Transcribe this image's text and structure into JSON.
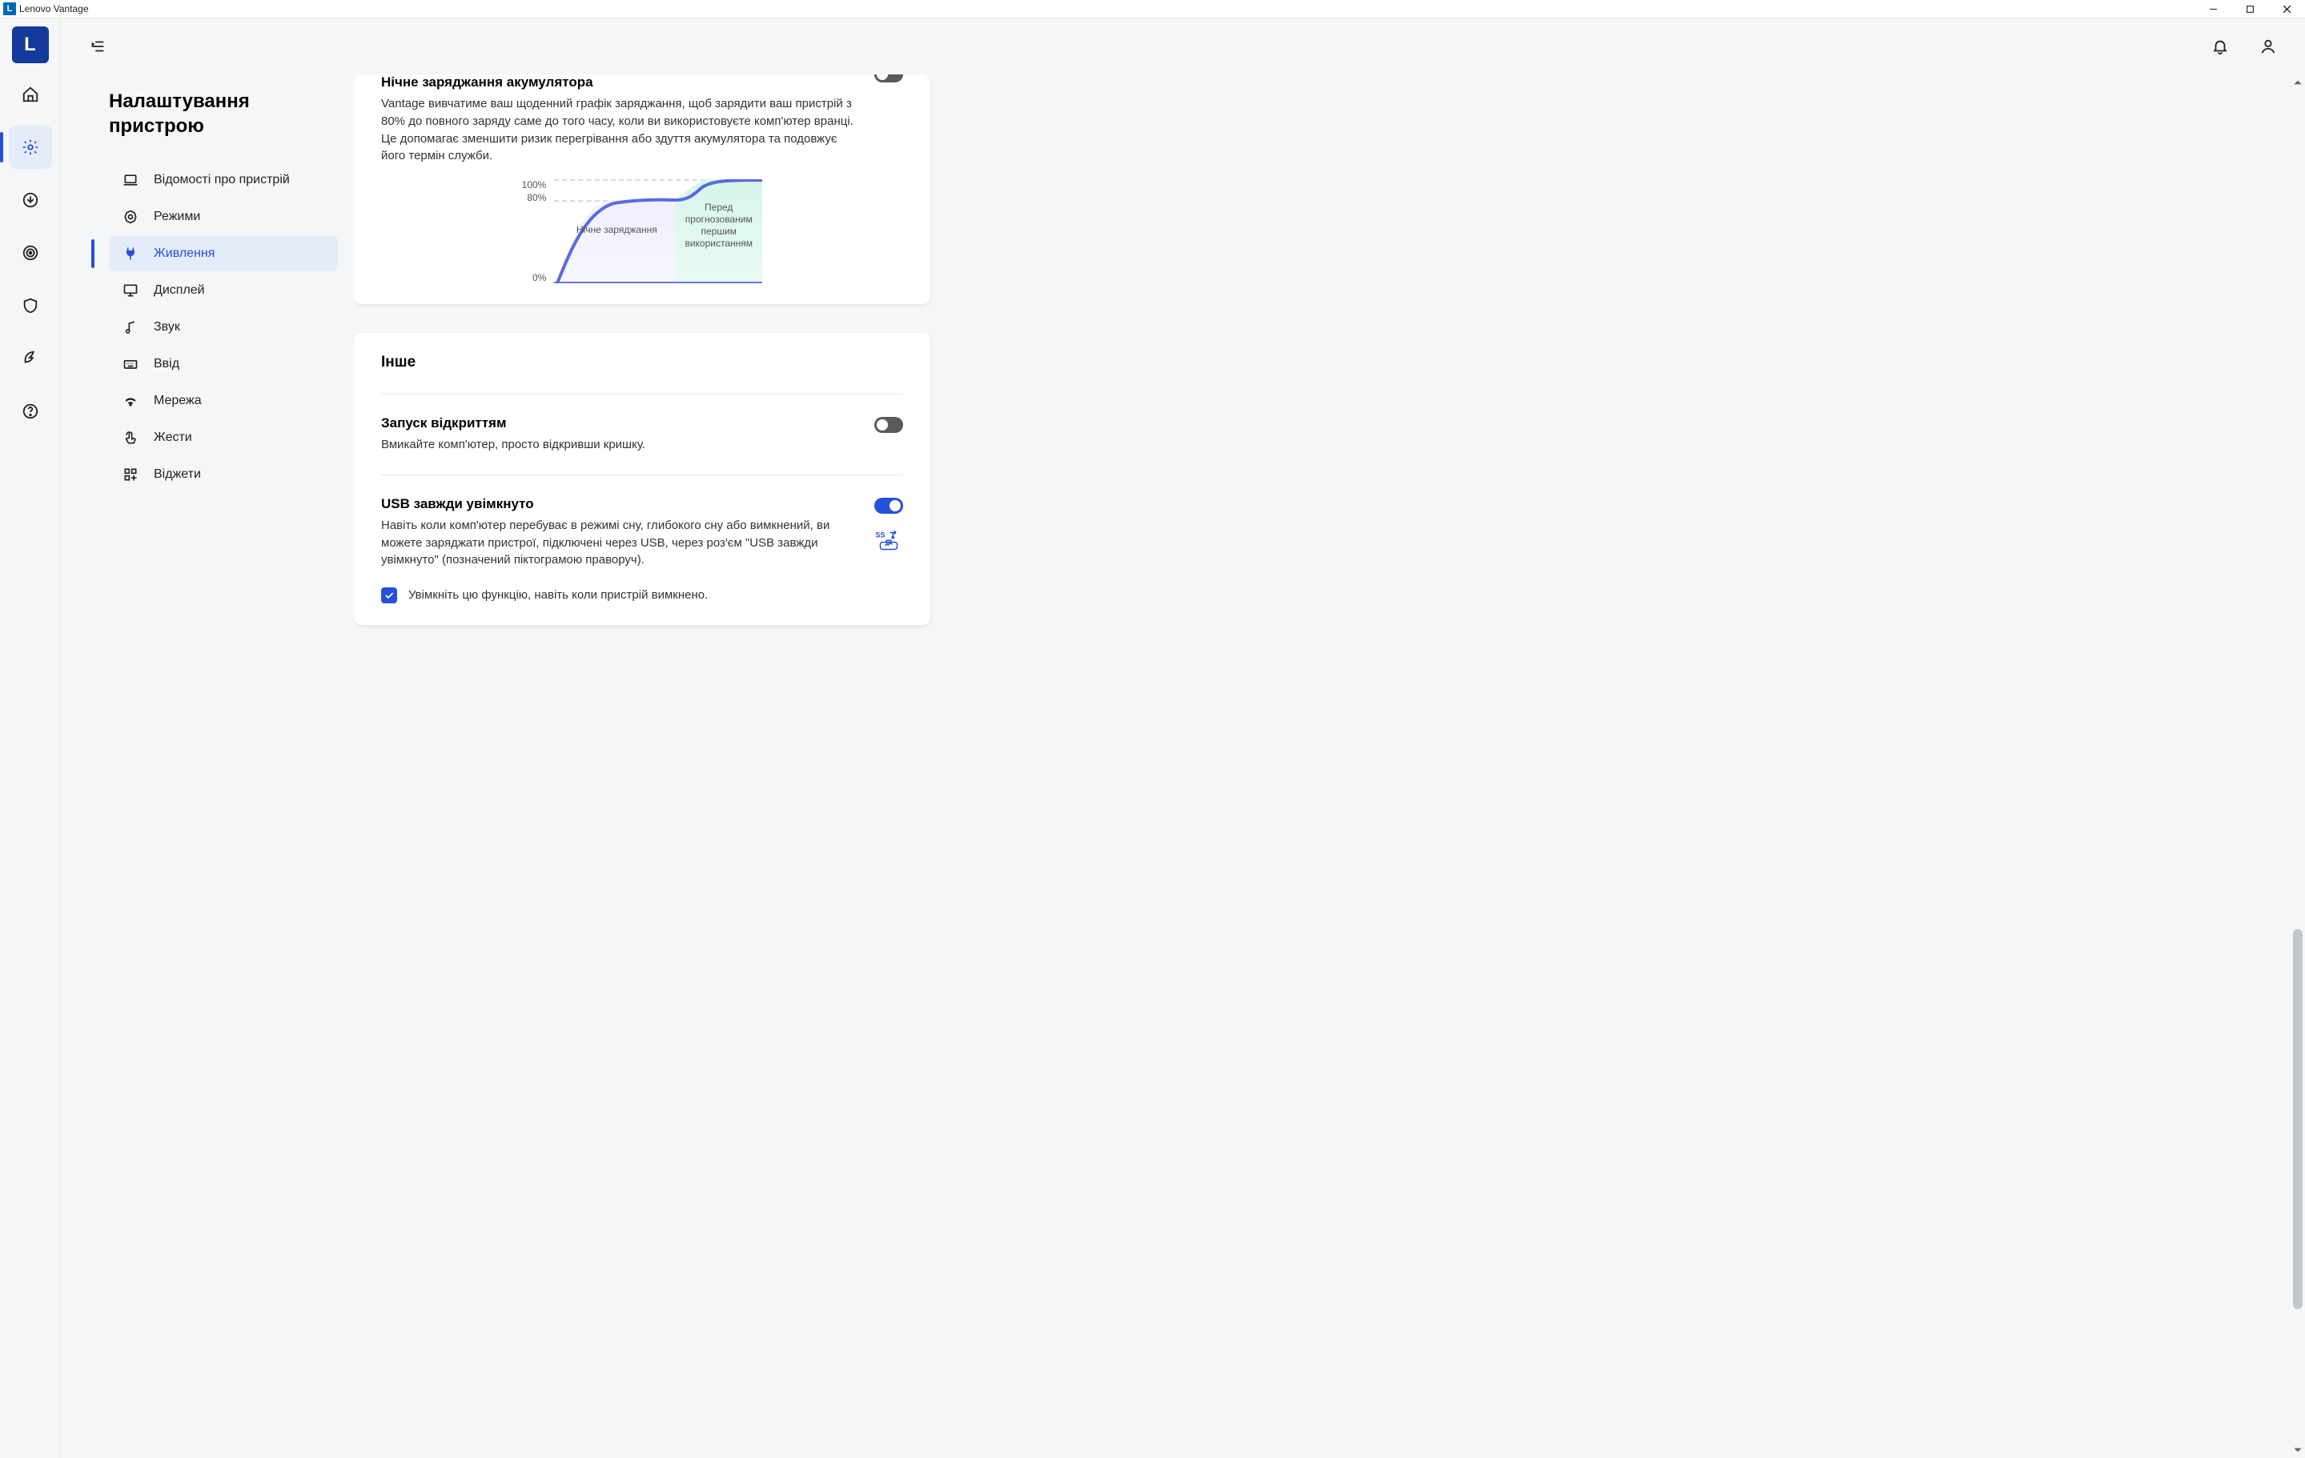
{
  "window": {
    "title": "Lenovo Vantage",
    "app_icon_letter": "L"
  },
  "logo_letter": "L",
  "rail": [
    {
      "id": "home"
    },
    {
      "id": "settings",
      "active": true
    },
    {
      "id": "downloads"
    },
    {
      "id": "diagnostics"
    },
    {
      "id": "security"
    },
    {
      "id": "performance"
    },
    {
      "id": "help"
    }
  ],
  "page_title": "Налаштування пристрою",
  "nav": [
    {
      "id": "device-info",
      "label": "Відомості про пристрій"
    },
    {
      "id": "modes",
      "label": "Режими"
    },
    {
      "id": "power",
      "label": "Живлення",
      "active": true
    },
    {
      "id": "display",
      "label": "Дисплей"
    },
    {
      "id": "audio",
      "label": "Звук"
    },
    {
      "id": "input",
      "label": "Ввід"
    },
    {
      "id": "network",
      "label": "Мережа"
    },
    {
      "id": "gestures",
      "label": "Жести"
    },
    {
      "id": "widgets",
      "label": "Віджети"
    }
  ],
  "night_charge": {
    "title": "Нічне заряджання акумулятора",
    "desc": "Vantage вивчатиме ваш щоденний графік заряджання, щоб зарядити ваш пристрій з 80% до повного заряду саме до того часу, коли ви використовуєте комп'ютер вранці. Це допомагає зменшити ризик перегрівання або здуття акумулятора та подовжує його термін служби.",
    "enabled": false
  },
  "other_section_title": "Інше",
  "flip_to_start": {
    "title": "Запуск відкриттям",
    "desc": "Вмикайте комп'ютер, просто відкривши кришку.",
    "enabled": false
  },
  "always_on_usb": {
    "title": "USB завжди увімкнуто",
    "desc": "Навіть коли комп'ютер перебуває в режимі сну, глибокого сну або вимкнений, ви можете заряджати пристрої, підключені через USB, через роз'єм \"USB завжди увімкнуто\" (позначений піктограмою праворуч).",
    "enabled": true,
    "checkbox_label": "Увімкніть цю функцію, навіть коли пристрій вимкнено.",
    "checkbox_checked": true
  },
  "chart_data": {
    "type": "line",
    "ylabel_ticks": [
      "100%",
      "80%",
      "0%"
    ],
    "ylim": [
      0,
      100
    ],
    "segments": [
      {
        "name": "night_charge_label",
        "label": "Нічне заряджання",
        "target_pct": 80
      },
      {
        "name": "before_first_use_label",
        "label": "Перед прогнозованим першим використанням",
        "target_pct": 100
      }
    ]
  }
}
